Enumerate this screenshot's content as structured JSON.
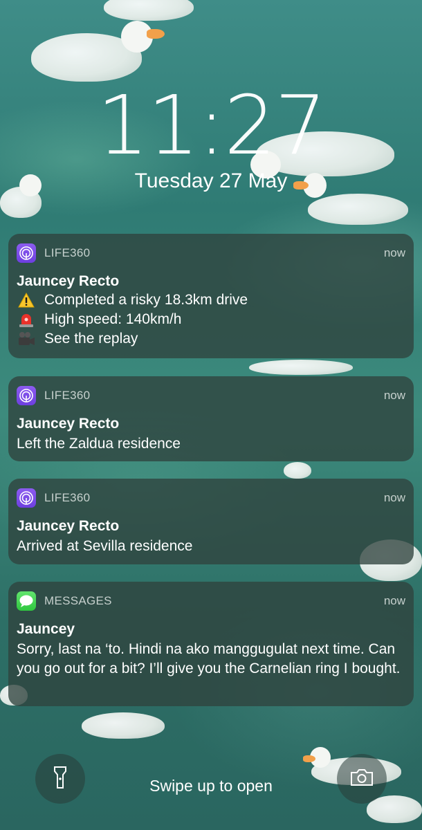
{
  "lock_screen": {
    "time": "11:27",
    "date": "Tuesday 27 May"
  },
  "notifications": [
    {
      "app_name": "LIFE360",
      "app_icon": "life360-icon",
      "time": "now",
      "sender": "Jauncey Recto",
      "lines": [
        {
          "icon": "warning-icon",
          "text": "Completed a risky 18.3km drive"
        },
        {
          "icon": "siren-icon",
          "text": "High speed: 140km/h"
        },
        {
          "icon": "video-camera-icon",
          "text": "See the replay"
        }
      ]
    },
    {
      "app_name": "LIFE360",
      "app_icon": "life360-icon",
      "time": "now",
      "sender": "Jauncey Recto",
      "message": "Left the Zaldua residence"
    },
    {
      "app_name": "LIFE360",
      "app_icon": "life360-icon",
      "time": "now",
      "sender": "Jauncey Recto",
      "message": "Arrived at Sevilla residence"
    },
    {
      "app_name": "MESSAGES",
      "app_icon": "messages-icon",
      "time": "now",
      "sender": "Jauncey",
      "message": "Sorry, last na ‘to. Hindi na ako manggugulat next time. Can you go out for a bit? I’ll give you the Carnelian ring I bought."
    }
  ],
  "bottom_bar": {
    "swipe_text": "Swipe up to open",
    "left_button_icon": "flashlight-icon",
    "right_button_icon": "camera-icon"
  },
  "colors": {
    "life360_accent": "#7b4ee8",
    "messages_accent": "#3fd24f",
    "notification_bg": "#30423e"
  }
}
